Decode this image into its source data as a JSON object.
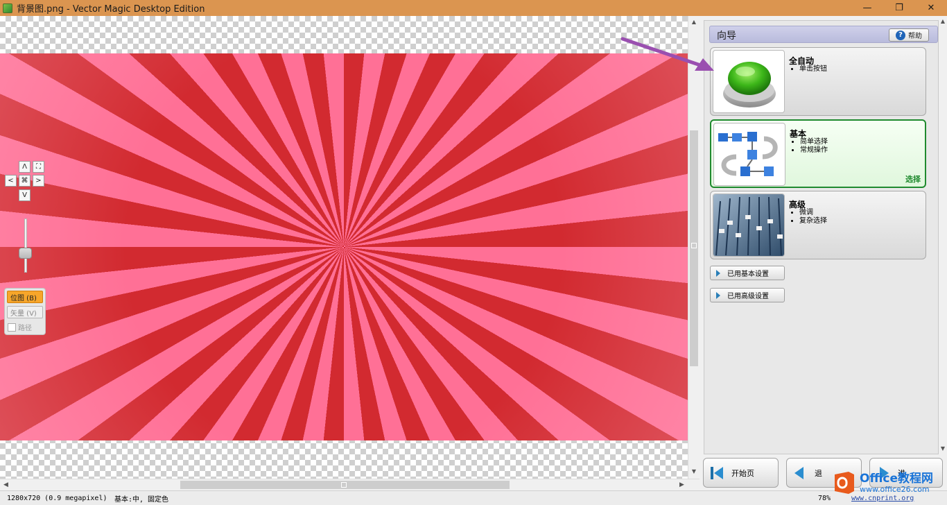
{
  "window": {
    "title": "背景图.png - Vector Magic Desktop Edition",
    "minimize_glyph": "—",
    "maximize_glyph": "❐",
    "close_glyph": "✕"
  },
  "nav": {
    "up": "Λ",
    "down": "V",
    "left": "<",
    "right": ">",
    "fit": "⌘",
    "zoom_fit": "⛶"
  },
  "zoom_slider": {
    "level": 0.68
  },
  "view_mode": {
    "bitmap": "位图 (B)",
    "vector": "矢量 (V)",
    "path_label": "路径"
  },
  "wizard": {
    "title": "向导",
    "help": "帮助",
    "cards": [
      {
        "title": "全自动",
        "bullets": [
          "单击按钮"
        ]
      },
      {
        "title": "基本",
        "bullets": [
          "简单选择",
          "常规操作"
        ],
        "selected_label": "选择"
      },
      {
        "title": "高级",
        "bullets": [
          "微调",
          "复杂选择"
        ]
      }
    ],
    "used_basic": "已用基本设置",
    "used_advanced": "已用高级设置"
  },
  "footer": {
    "start": "开始页",
    "back": "退",
    "next": "进"
  },
  "status": {
    "image_info": "1280x720 (0.9 megapixel)",
    "mode_info": "基本:中, 固定色",
    "zoom": "78%",
    "link": "www.cnprint.org"
  },
  "watermark": {
    "line1": "Office教程网",
    "line2": "www.office26.com"
  },
  "colors": {
    "titlebar": "#db9550",
    "stripe_red": "#d22a30",
    "stripe_pink": "#ff7096",
    "selected_green": "#1f8a2e",
    "active_orange": "#f7a62a"
  }
}
